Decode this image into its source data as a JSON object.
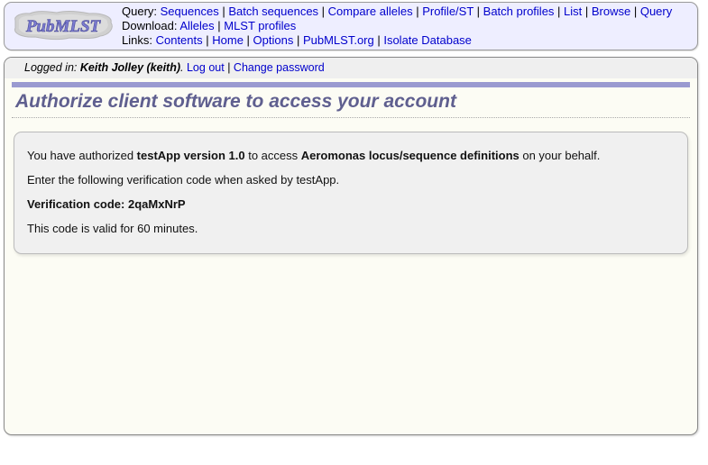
{
  "header": {
    "logo_text": "PubMLST",
    "nav": [
      {
        "label": "Query:",
        "links": [
          "Sequences",
          "Batch sequences",
          "Compare alleles",
          "Profile/ST",
          "Batch profiles",
          "List",
          "Browse",
          "Query"
        ]
      },
      {
        "label": "Download:",
        "links": [
          "Alleles",
          "MLST profiles"
        ]
      },
      {
        "label": "Links:",
        "links": [
          "Contents",
          "Home",
          "Options",
          "PubMLST.org",
          "Isolate Database"
        ]
      }
    ]
  },
  "session": {
    "prefix": "Logged in:",
    "user": "Keith Jolley (keith)",
    "suffix": ".",
    "logout_label": "Log out",
    "separator": "|",
    "change_password_label": "Change password"
  },
  "page": {
    "title": "Authorize client software to access your account"
  },
  "content": {
    "line1_before": "You have authorized ",
    "line1_app": "testApp version 1.0",
    "line1_middle": " to access ",
    "line1_resource": "Aeromonas locus/sequence definitions",
    "line1_after": " on your behalf.",
    "line2": "Enter the following verification code when asked by testApp.",
    "code_label": "Verification code:",
    "code_value": "2qaMxNrP",
    "line4": "This code is valid for 60 minutes."
  },
  "colors": {
    "link": "#0000cc",
    "heading": "#5f5f8f",
    "accent_bar": "#9a9ad0",
    "header_bg": "#eeeeff",
    "content_bg": "#f0f0f0",
    "page_bg": "#fcfcf4"
  }
}
